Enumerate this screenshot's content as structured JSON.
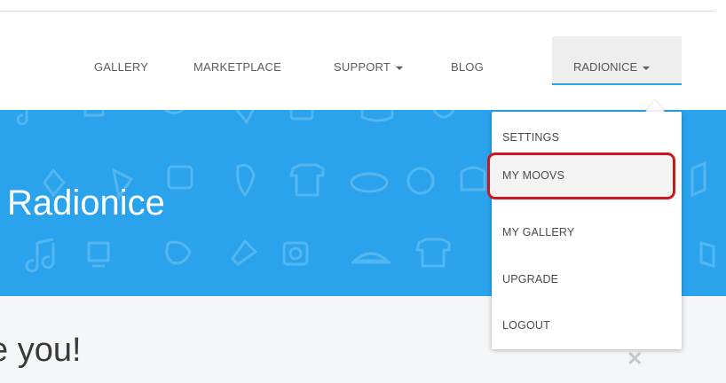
{
  "nav": {
    "links": [
      "GALLERY",
      "MARKETPLACE",
      "SUPPORT",
      "BLOG"
    ],
    "account_label": "RADIONICE"
  },
  "hero": {
    "title": "Radionice",
    "background_color": "#2aa3ec"
  },
  "welcome_text": "e you!",
  "close_icon": "close-icon",
  "dropdown": {
    "items": [
      "SETTINGS",
      "MY MOOVS",
      "MY GALLERY",
      "UPGRADE",
      "LOGOUT"
    ],
    "highlighted_item": "MY MOOVS",
    "highlight_color": "#d2141c"
  }
}
